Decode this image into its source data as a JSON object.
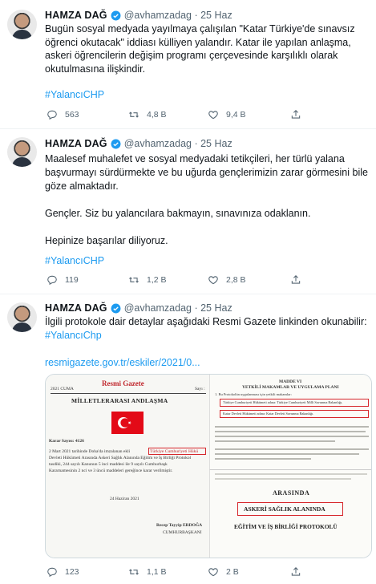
{
  "tweets": [
    {
      "name": "HAMZA DAĞ",
      "handle": "@avhamzadag · 25 Haz",
      "paragraphs": [
        "Bugün sosyal medyada yayılmaya çalışılan \"Katar Türkiye'de sınavsız öğrenci okutacak\" iddiası külliyen yalandır. Katar ile yapılan anlaşma, askeri öğrencilerin değişim programı çerçevesinde karşılıklı olarak okutulmasına ilişkindir."
      ],
      "hashtag": "#YalancıCHP",
      "replies": "563",
      "retweets": "4,8 B",
      "likes": "9,4 B"
    },
    {
      "name": "HAMZA DAĞ",
      "handle": "@avhamzadag · 25 Haz",
      "paragraphs": [
        "Maalesef muhalefet ve sosyal medyadaki tetikçileri, her türlü yalana başvurmayı sürdürmekte ve bu uğurda gençlerimizin zarar görmesini bile göze almaktadır.",
        "Gençler. Siz bu yalancılara bakmayın, sınavınıza odaklanın.",
        "Hepinize başarılar diliyoruz."
      ],
      "hashtag": "#YalancıCHP",
      "replies": "119",
      "retweets": "1,2 B",
      "likes": "2,8 B"
    },
    {
      "name": "HAMZA DAĞ",
      "handle": "@avhamzadag · 25 Haz",
      "paragraphs": [
        "İlgili protokole dair detaylar aşağıdaki Resmi Gazete linkinden okunabilir:"
      ],
      "hashtag": "#YalancıChp",
      "link": "resmigazete.gov.tr/eskiler/2021/0...",
      "replies": "123",
      "retweets": "1,1 B",
      "likes": "2 B"
    }
  ],
  "card": {
    "left": {
      "date": "2021 CUMA",
      "masthead": "Resmi Gazete",
      "sayi": "Sayı :",
      "heading": "MİLLETLERARASI ANDLAŞMA",
      "karar": "Karar Sayısı: 4126",
      "highlight": "Türkiye Cumhuriyeti Hükü",
      "lines": [
        "2 Mart 2021 tarihinde Doha'da imzalanan ekli",
        "Devleti Hükümeti Arasında Askeri Sağlık Alanında Eğitim ve İş Birliği Protokol",
        "tasdiki, 244 sayılı Kanunun 5 inci maddesi ile 9 sayılı Cumhurbaşk",
        "Kararnamesinin 2 nci ve 3 üncü maddeleri gereğince karar verilmiştir."
      ],
      "sign_date": "24 Haziran 2021",
      "signer": "Recep Tayyip ERDOĞA",
      "office": "CUMHURBAŞKANI"
    },
    "right_top": {
      "madde": "MADDE VI",
      "title": "YETKİLİ MAKAMLAR VE UYGULAMA PLANI",
      "intro": "1. Bu Protokolün uygulanması için yetkili makamlar:",
      "box1": "Türkiye Cumhuriyeti Hükümeti adına: Türkiye Cumhuriyeti Milli Savunma Bakanlığı,",
      "box2": "Katar Devleti Hükümeti adına: Katar Devleti Savunma Bakanlığı."
    },
    "right_bottom": {
      "arasinda": "ARASINDA",
      "boxed": "ASKERİ SAĞLIK ALANINDA",
      "protocol": "EĞİTİM VE İŞ BİRLİĞİ PROTOKOLÜ"
    }
  },
  "colors": {
    "accent": "#1d9bf0",
    "muted": "#536471",
    "flag_red": "#e30a17",
    "highlight_red": "#d6262b"
  }
}
